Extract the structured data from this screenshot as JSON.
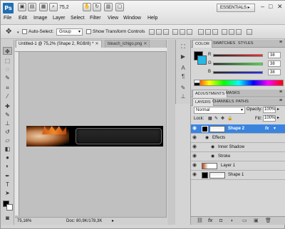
{
  "app": {
    "logo": "Ps",
    "zoom": "75,2",
    "workspace": "ESSENTIALS",
    "window_controls": [
      "–",
      "□",
      "✕"
    ]
  },
  "menu": [
    "File",
    "Edit",
    "Image",
    "Layer",
    "Select",
    "Filter",
    "View",
    "Window",
    "Help"
  ],
  "options": {
    "auto_select_label": "Auto-Select:",
    "auto_select_value": "Group",
    "show_transform_label": "Show Transform Controls"
  },
  "document": {
    "tabs": [
      {
        "label": "Untitled-1 @ 75,2% (Shape 2, RGB/8) *",
        "active": true
      },
      {
        "label": "bleach_ichigo.png",
        "active": false
      }
    ],
    "zoom_status": "75,16%",
    "doc_status": "Doc: 80,9K/178,3K"
  },
  "color_panel": {
    "tabs": [
      "COLOR",
      "SWATCHES",
      "STYLES"
    ],
    "channels": [
      {
        "label": "R",
        "value": "38"
      },
      {
        "label": "G",
        "value": "38"
      },
      {
        "label": "B",
        "value": "38"
      }
    ],
    "colors": {
      "foreground": "#000000",
      "background": "#26b9e8"
    }
  },
  "adjustments_panel": {
    "tabs": [
      "ADJUSTMENTS",
      "MASKS"
    ]
  },
  "layers_panel": {
    "tabs": [
      "LAYERS",
      "CHANNELS",
      "PATHS"
    ],
    "blend_mode": "Normal",
    "opacity_label": "Opacity:",
    "opacity": "100%",
    "lock_label": "Lock:",
    "fill_label": "Fill:",
    "fill": "100%",
    "layers": [
      {
        "name": "Shape 2",
        "selected": true,
        "fx": "fx"
      },
      {
        "name": "Effects",
        "sub": true
      },
      {
        "name": "Inner Shadow",
        "sub": true
      },
      {
        "name": "Stroke",
        "sub": true
      },
      {
        "name": "Layer 1"
      },
      {
        "name": "Shape 1"
      }
    ]
  }
}
